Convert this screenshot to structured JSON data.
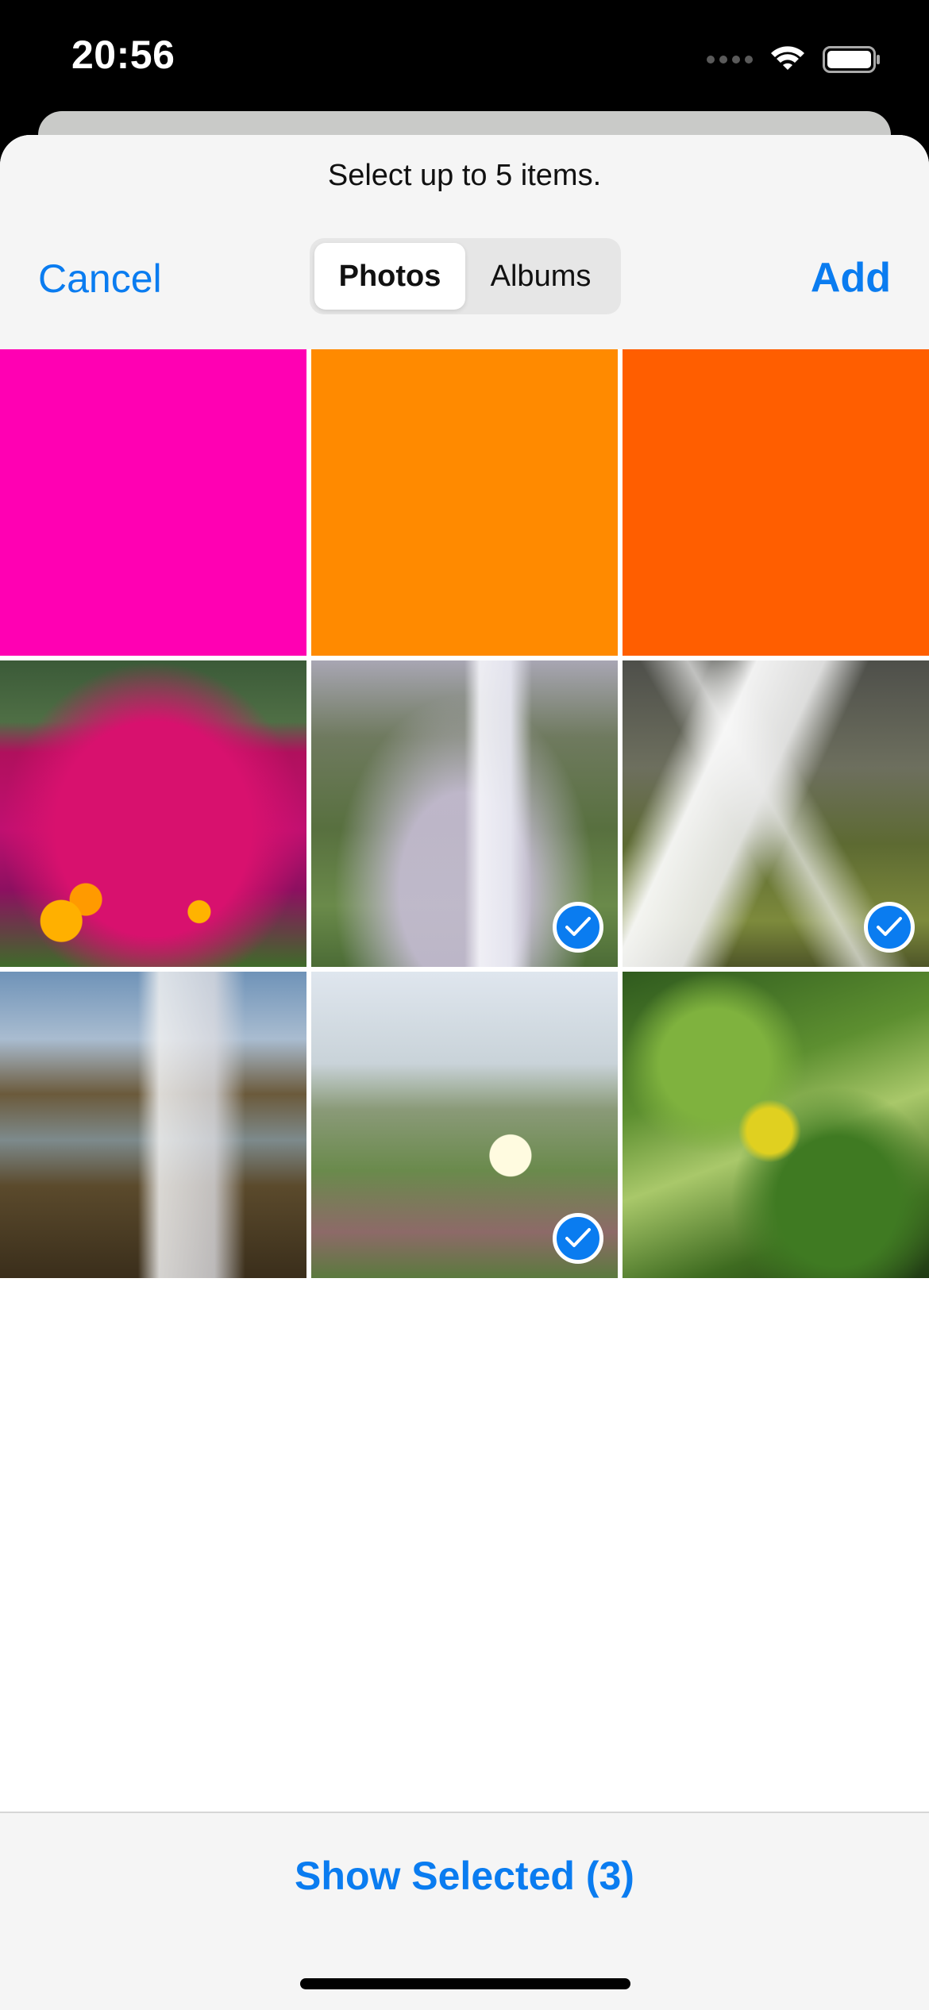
{
  "status_bar": {
    "time": "20:56",
    "icons": [
      "signal-dots-icon",
      "wifi-icon",
      "battery-icon"
    ]
  },
  "sheet": {
    "prompt": "Select up to 5 items.",
    "cancel_label": "Cancel",
    "add_label": "Add",
    "segments": [
      {
        "label": "Photos",
        "selected": true
      },
      {
        "label": "Albums",
        "selected": false
      }
    ]
  },
  "grid": {
    "items": [
      {
        "kind": "color",
        "color": "#ff00b3",
        "selected": false
      },
      {
        "kind": "color",
        "color": "#ff8a00",
        "selected": false
      },
      {
        "kind": "color",
        "color": "#ff5e00",
        "selected": false
      },
      {
        "kind": "photo",
        "subject": "magenta flowers",
        "selected": false
      },
      {
        "kind": "photo",
        "subject": "waterfall valley",
        "selected": true
      },
      {
        "kind": "photo",
        "subject": "waterfall over mossy rocks",
        "selected": true
      },
      {
        "kind": "photo",
        "subject": "waterfall at coast",
        "selected": false
      },
      {
        "kind": "photo",
        "subject": "dune grass flower",
        "selected": true
      },
      {
        "kind": "photo",
        "subject": "green leaves",
        "selected": false
      }
    ]
  },
  "toolbar": {
    "show_selected_label": "Show Selected (3)"
  },
  "colors": {
    "accent": "#0a7cf0",
    "header_bg": "#f5f5f5"
  }
}
